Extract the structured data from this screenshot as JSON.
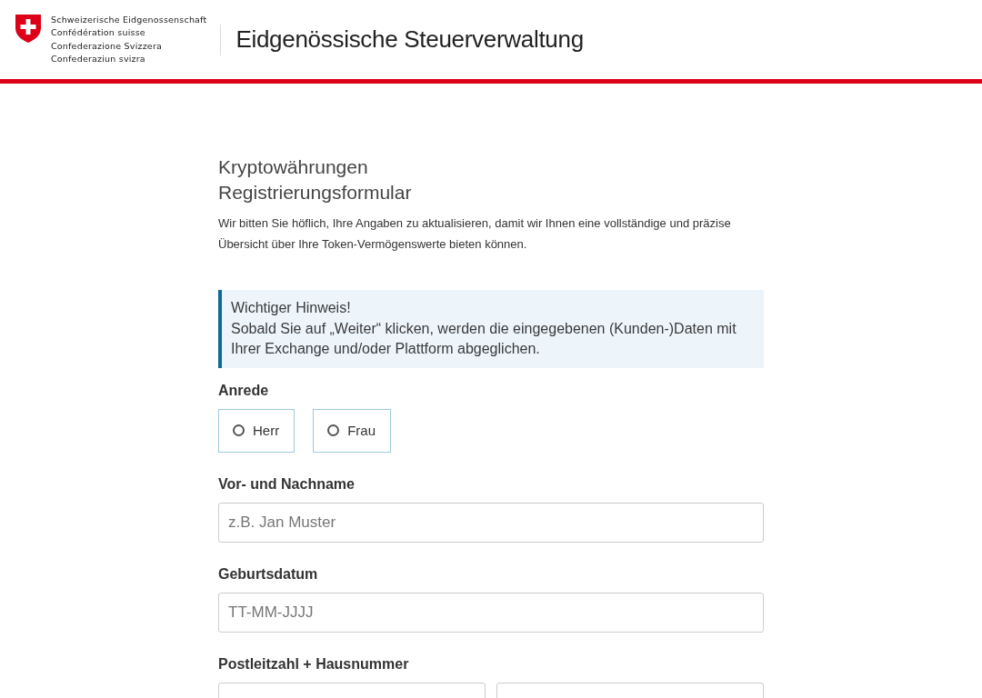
{
  "header": {
    "country_lines": [
      "Schweizerische Eidgenossenschaft",
      "Confédération suisse",
      "Confederazione Svizzera",
      "Confederaziun svizra"
    ],
    "agency": "Eidgenössische Steuerverwaltung"
  },
  "form": {
    "title_lines": [
      "Kryptowährungen",
      "Registrierungsformular"
    ],
    "intro": "Wir bitten Sie höflich, Ihre Angaben zu aktualisieren, damit wir Ihnen eine vollständige und präzise Übersicht über Ihre Token-Vermögenswerte bieten können.",
    "notice": {
      "title": "Wichtiger Hinweis!",
      "text": "Sobald Sie auf „Weiter“ klicken, werden die eingegebenen (Kunden-)Daten mit Ihrer Exchange und/oder Plattform abgeglichen."
    },
    "salutation": {
      "label": "Anrede",
      "options": [
        {
          "label": "Herr",
          "selected": false
        },
        {
          "label": "Frau",
          "selected": false
        }
      ]
    },
    "fields": [
      {
        "label": "Vor- und Nachname",
        "inputs": [
          {
            "kind": "input",
            "placeholder": "z.B. Jan Muster"
          }
        ]
      },
      {
        "label": "Geburtsdatum",
        "inputs": [
          {
            "kind": "input",
            "placeholder": "TT-MM-JJJJ"
          }
        ]
      },
      {
        "label": "Postleitzahl + Hausnummer",
        "inputs": [
          {
            "kind": "input"
          },
          {
            "kind": "input"
          }
        ]
      }
    ]
  }
}
